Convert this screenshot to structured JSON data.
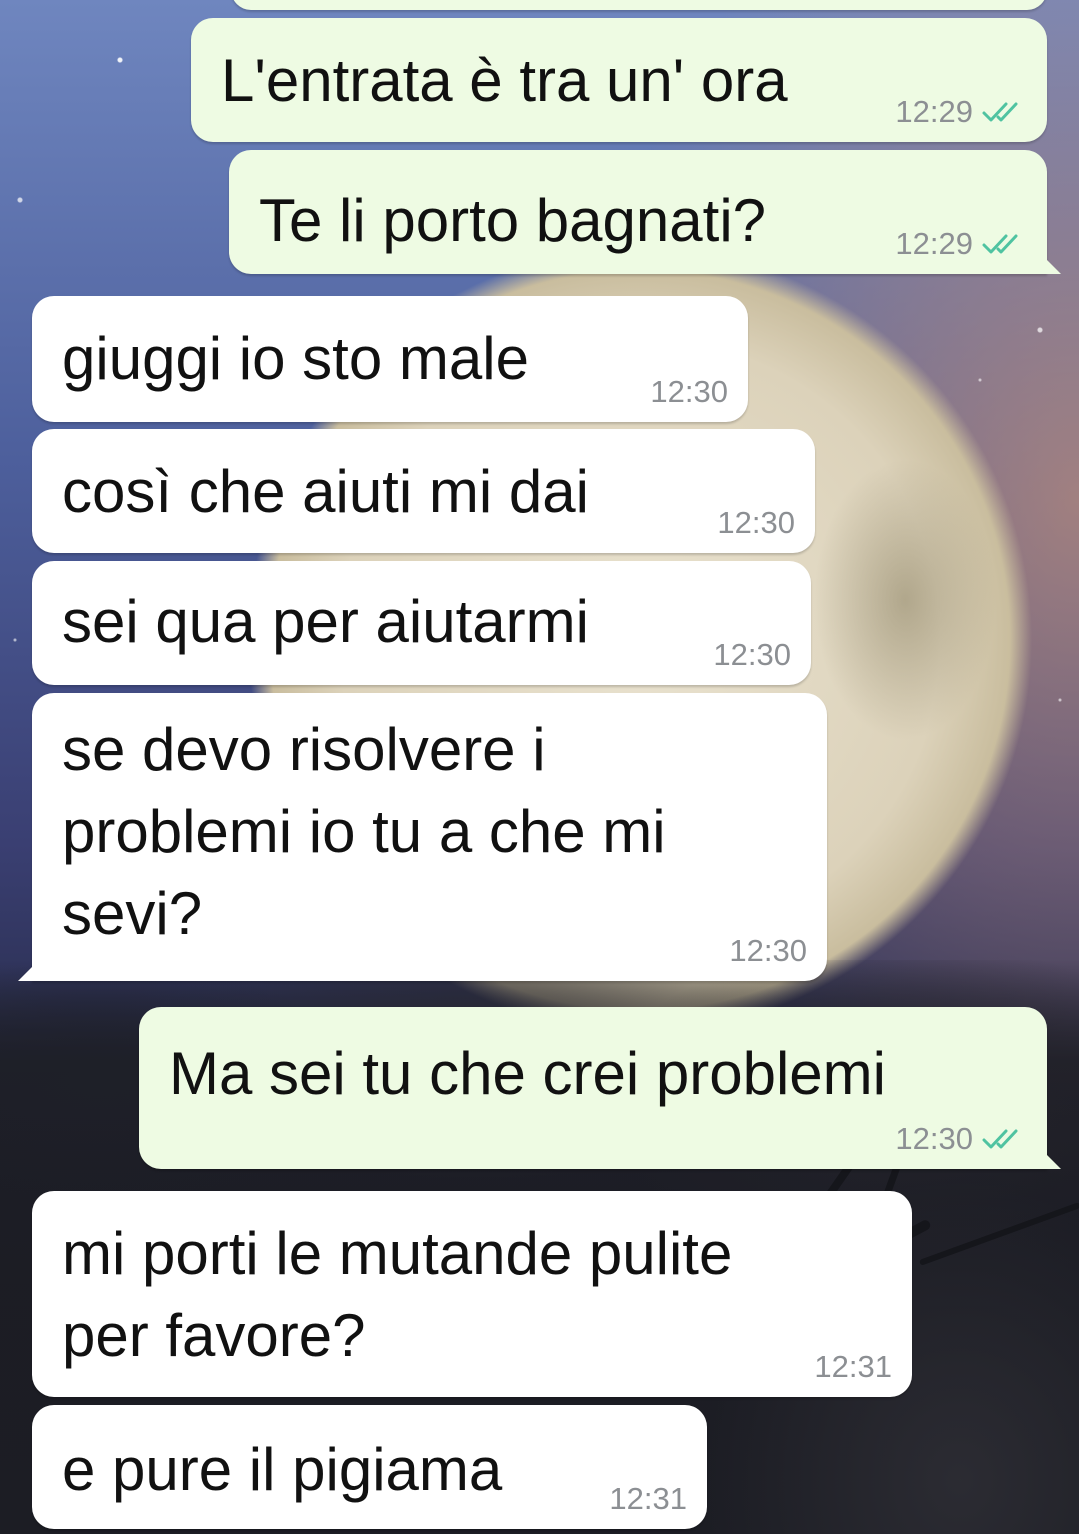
{
  "conversation": {
    "messages": [
      {
        "direction": "out",
        "text": "L'entrata è tra un' ora",
        "time": "12:29",
        "status": "read"
      },
      {
        "direction": "out",
        "text": "Te li porto bagnati?",
        "time": "12:29",
        "status": "read"
      },
      {
        "direction": "in",
        "text": "giuggi io sto male",
        "time": "12:30"
      },
      {
        "direction": "in",
        "text": "così che aiuti mi dai",
        "time": "12:30"
      },
      {
        "direction": "in",
        "text": "sei qua per aiutarmi",
        "time": "12:30"
      },
      {
        "direction": "in",
        "text": "se devo risolvere i\nproblemi io tu a che mi\nsevi?",
        "time": "12:30"
      },
      {
        "direction": "out",
        "text": "Ma sei tu che crei problemi",
        "time": "12:30",
        "status": "read"
      },
      {
        "direction": "in",
        "text": "mi porti le mutande pulite\nper favore?",
        "time": "12:31"
      },
      {
        "direction": "in",
        "text": "e pure il pigiama",
        "time": "12:31"
      }
    ]
  },
  "colors": {
    "incoming_bubble": "#ffffff",
    "outgoing_bubble": "#eefbe3",
    "read_tick": "#4fc3a1",
    "timestamp": "#8c8f93"
  },
  "icons": {
    "read_receipt": "double-check-icon"
  }
}
